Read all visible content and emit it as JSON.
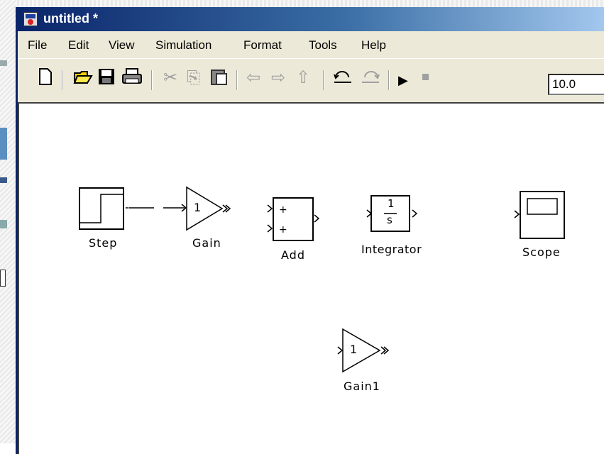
{
  "window": {
    "title": "untitled *"
  },
  "menu": [
    "File",
    "Edit",
    "View",
    "Simulation",
    "Format",
    "Tools",
    "Help"
  ],
  "toolbar": {
    "icons": [
      "new-model-icon",
      "open-icon",
      "save-icon",
      "print-icon",
      "cut-icon",
      "copy-icon",
      "paste-icon",
      "back-icon",
      "forward-icon",
      "up-icon",
      "undo-icon",
      "redo-icon",
      "start-simulation-icon",
      "stop-simulation-icon"
    ],
    "stop_time": "10.0"
  },
  "blocks": {
    "step": {
      "label": "Step"
    },
    "gain": {
      "label": "Gain",
      "value": "1"
    },
    "add": {
      "label": "Add",
      "sign1": "+",
      "sign2": "+"
    },
    "integrator": {
      "label": "Integrator",
      "num": "1",
      "den": "s"
    },
    "scope": {
      "label": "Scope"
    },
    "gain1": {
      "label": "Gain1",
      "value": "1"
    }
  }
}
